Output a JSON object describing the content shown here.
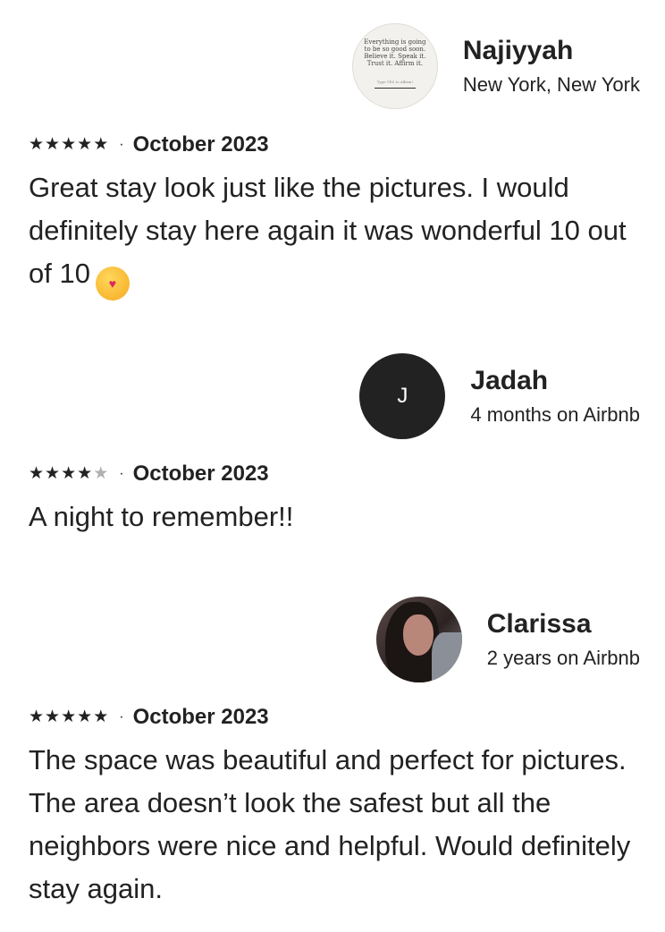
{
  "reviews": [
    {
      "name": "Najiyyah",
      "subtitle": "New York, New York",
      "avatar": {
        "type": "quote-image",
        "quote": "Everything is going to be so good soon. Believe it. Speak it. Trust it. Affirm it.",
        "footnote": "Type YES to Affirm!"
      },
      "rating": 5,
      "date": "October 2023",
      "text": "Great stay look just like the pictures. I would definitely stay here again it was wonderful 10 out of 10",
      "emoji": "🥰"
    },
    {
      "name": "Jadah",
      "subtitle": "4 months on Airbnb",
      "avatar": {
        "type": "initial",
        "initial": "J"
      },
      "rating": 4,
      "date": "October 2023",
      "text": "A night to remember!!"
    },
    {
      "name": "Clarissa",
      "subtitle": "2 years on Airbnb",
      "avatar": {
        "type": "photo"
      },
      "rating": 5,
      "date": "October 2023",
      "text": "The space was beautiful and perfect for pictures. The area doesn’t look the safest but all the neighbors were nice and helpful. Would definitely stay again."
    }
  ],
  "separator": "·",
  "colors": {
    "text": "#222222",
    "star_empty": "#b0b0b0",
    "avatar_initial_bg": "#222222"
  }
}
